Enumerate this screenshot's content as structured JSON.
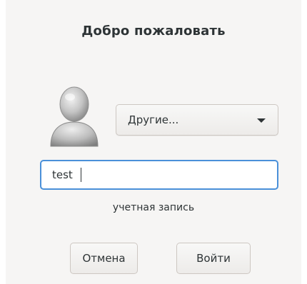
{
  "dialog": {
    "title": "Добро пожаловать"
  },
  "user_select": {
    "selected": "Другие...",
    "icon": "chevron-down-icon"
  },
  "avatar": {
    "icon": "user-avatar-icon"
  },
  "username_field": {
    "value": "test"
  },
  "hint": "учетная запись",
  "buttons": {
    "cancel_label": "Отмена",
    "login_label": "Войти"
  },
  "colors": {
    "background": "#f6f5f4",
    "focus_border": "#4a90d9",
    "text": "#2e3436"
  }
}
